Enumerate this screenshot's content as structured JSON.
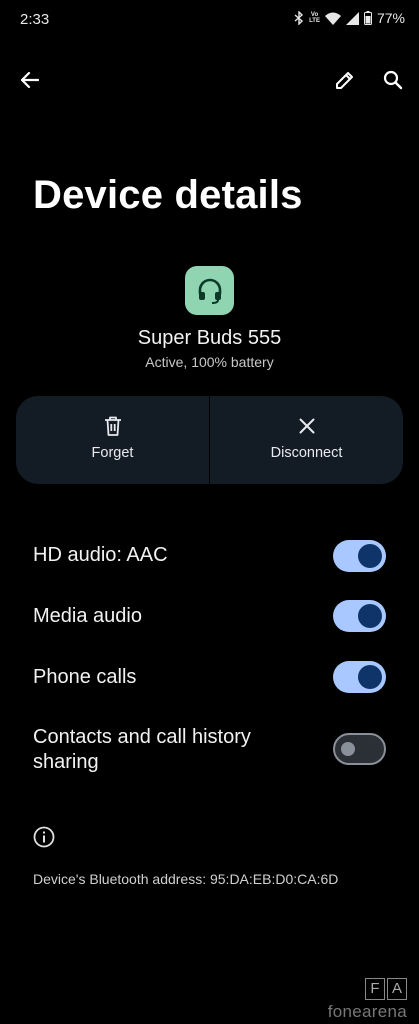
{
  "status_bar": {
    "time": "2:33",
    "battery": "77%",
    "icons": [
      "bluetooth-icon",
      "volte-icon",
      "wifi-icon",
      "signal-icon",
      "battery-icon"
    ],
    "volte_top": "Vo",
    "volte_bottom": "LTE"
  },
  "toolbar": {
    "icons": [
      "back-arrow-icon",
      "edit-pencil-icon",
      "search-icon"
    ]
  },
  "page_title": "Device details",
  "device": {
    "icon": "headset-icon",
    "name": "Super Buds 555",
    "status": "Active, 100% battery"
  },
  "actions": [
    {
      "label": "Forget",
      "icon": "trash-icon"
    },
    {
      "label": "Disconnect",
      "icon": "close-icon"
    }
  ],
  "settings": [
    {
      "label": "HD audio: AAC",
      "enabled": true
    },
    {
      "label": "Media audio",
      "enabled": true
    },
    {
      "label": "Phone calls",
      "enabled": true
    },
    {
      "label": "Contacts and call history sharing",
      "enabled": false
    }
  ],
  "footer": {
    "info_icon": "info-icon",
    "bt_address": "Device's Bluetooth address: 95:DA:EB:D0:CA:6D"
  },
  "watermark": {
    "letters": [
      "F",
      "A"
    ],
    "text": "fonearena"
  },
  "colors": {
    "background": "#000000",
    "toggle_on_track": "#a8c8ff",
    "toggle_on_knob": "#0e3469",
    "action_bar": "#131b24",
    "device_icon_bg": "#8fd5b2"
  }
}
